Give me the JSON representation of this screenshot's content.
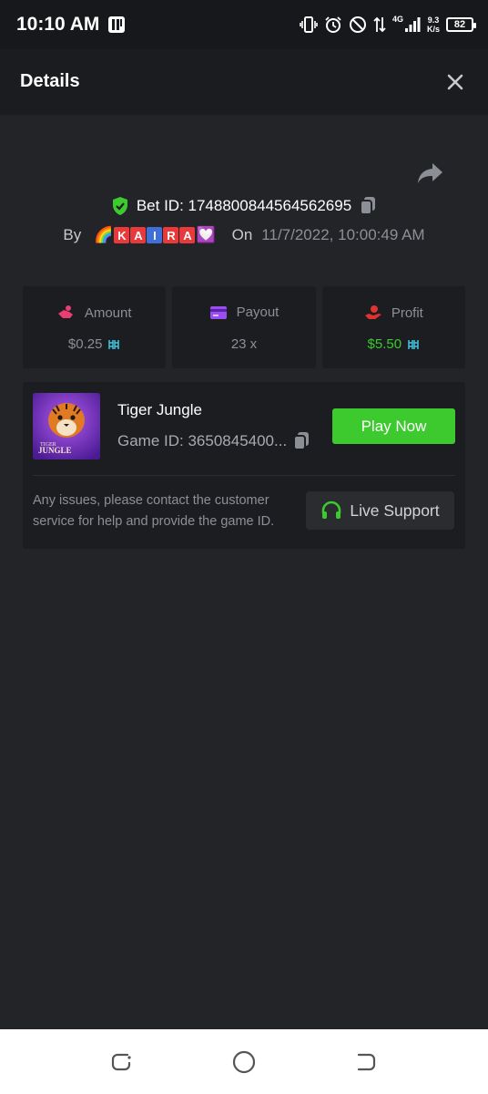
{
  "status_bar": {
    "time": "10:10 AM",
    "network": "4G",
    "speed_value": "9.3",
    "speed_unit": "K/s",
    "battery": "82",
    "icons": [
      "sim-badge-icon",
      "vibrate-icon",
      "alarm-icon",
      "dnd-icon",
      "data-transfer-icon",
      "signal-icon",
      "battery-icon"
    ]
  },
  "header": {
    "title": "Details",
    "close_icon": "close-icon"
  },
  "bet": {
    "bet_id_label": "Bet ID: 1748800844564562695",
    "by_label": "By",
    "user_letters": [
      "K",
      "A",
      "I",
      "R",
      "A"
    ],
    "on_label": "On",
    "date": "11/7/2022, 10:00:49 AM"
  },
  "stats": {
    "amount": {
      "label": "Amount",
      "value": "$0.25"
    },
    "payout": {
      "label": "Payout",
      "value": "23 x"
    },
    "profit": {
      "label": "Profit",
      "value": "$5.50"
    }
  },
  "game": {
    "name": "Tiger Jungle",
    "game_id": "Game ID: 3650845400...",
    "play_button": "Play Now",
    "thumb_line1": "TIGER",
    "thumb_line2": "JUNGLE"
  },
  "support": {
    "help_text": "Any issues, please contact the customer service for help and provide the game ID.",
    "button_label": "Live Support"
  },
  "colors": {
    "accent_green": "#3dca2e",
    "background": "#232428",
    "card": "#1c1d20"
  }
}
